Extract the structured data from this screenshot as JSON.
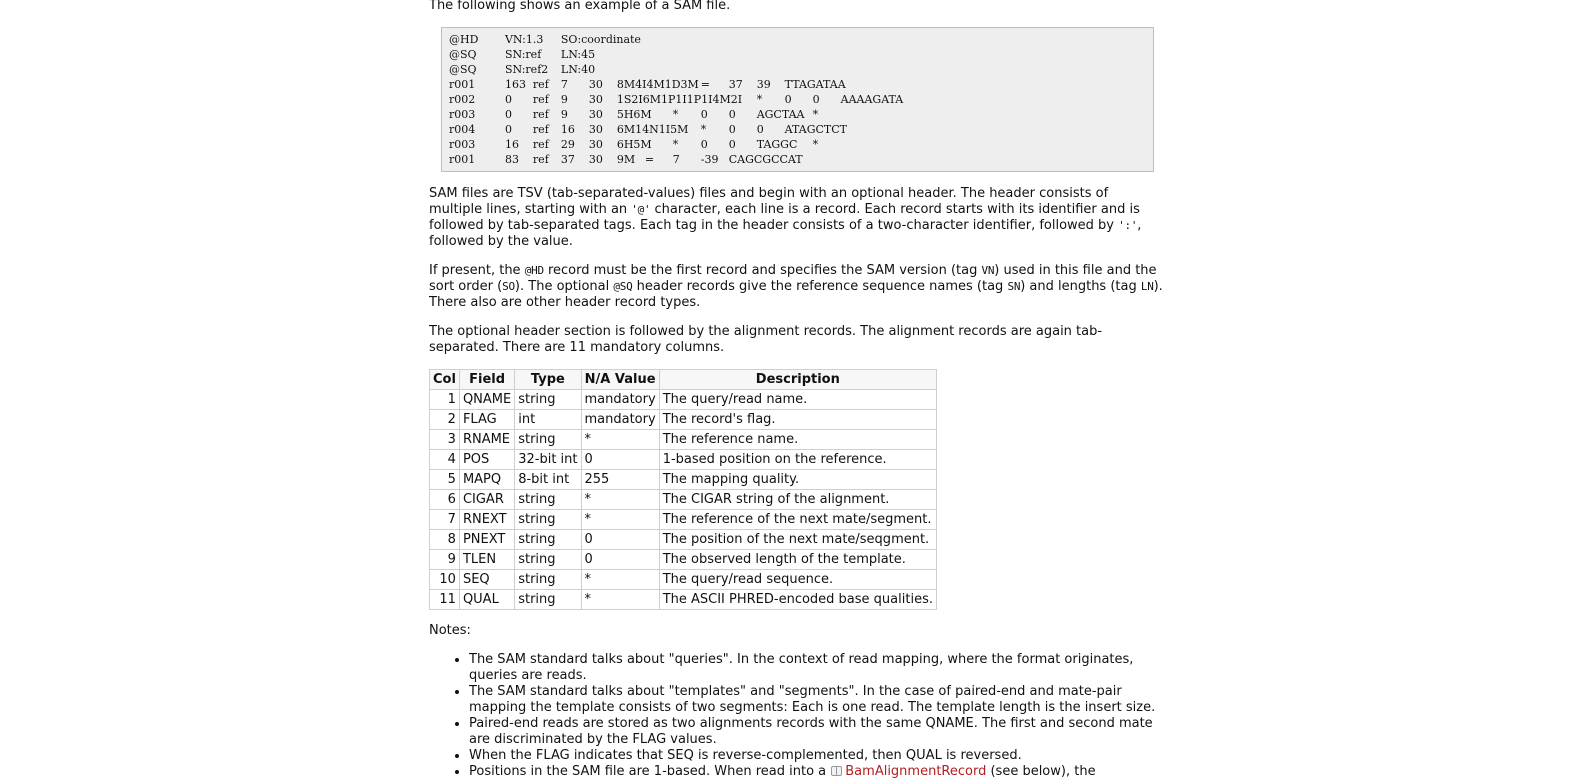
{
  "intro": "The following shows an example of a SAM file.",
  "example_sam": "@HD\tVN:1.3\tSO:coordinate\n@SQ\tSN:ref\tLN:45\n@SQ\tSN:ref2\tLN:40\nr001\t163\tref\t7\t30\t8M4I4M1D3M\t=\t37\t39\tTTAGATAA\nr002\t0\tref\t9\t30\t1S2I6M1P1I1P1I4M2I\t*\t0\t0\tAAAAGATA\nr003\t0\tref\t9\t30\t5H6M\t*\t0\t0\tAGCTAA\t*\nr004\t0\tref\t16\t30\t6M14N1I5M\t*\t0\t0\tATAGCTCT\nr003\t16\tref\t29\t30\t6H5M\t*\t0\t0\tTAGGC\t*\nr001\t83\tref\t37\t30\t9M\t=\t7\t-39\tCAGCGCCAT",
  "p1": {
    "t1": "SAM files are TSV (tab-separated-values) files and begin with an optional header. The header consists of multiple lines, starting with an ",
    "c1": "'@'",
    "t2": " character, each line is a record. Each record starts with its identifier and is followed by tab-separated tags. Each tag in the header consists of a two-character identifier, followed by ",
    "c2": "':'",
    "t3": ", followed by the value."
  },
  "p2": {
    "t1": "If present, the ",
    "c1": "@HD",
    "t2": " record must be the first record and specifies the SAM version (tag ",
    "c2": "VN",
    "t3": ") used in this file and the sort order (",
    "c3": "SO",
    "t4": "). The optional ",
    "c4": "@SQ",
    "t5": " header records give the reference sequence names (tag ",
    "c5": "SN",
    "t6": ") and lengths (tag ",
    "c6": "LN",
    "t7": "). There also are other header record types."
  },
  "p3": "The optional header section is followed by the alignment records. The alignment records are again tab-separated. There are 11 mandatory columns.",
  "table": {
    "headers": [
      "Col",
      "Field",
      "Type",
      "N/A Value",
      "Description"
    ],
    "rows": [
      [
        "1",
        "QNAME",
        "string",
        "mandatory",
        "The query/read name."
      ],
      [
        "2",
        "FLAG",
        "int",
        "mandatory",
        "The record's flag."
      ],
      [
        "3",
        "RNAME",
        "string",
        "*",
        "The reference name."
      ],
      [
        "4",
        "POS",
        "32-bit int",
        "0",
        "1-based position on the reference."
      ],
      [
        "5",
        "MAPQ",
        "8-bit int",
        "255",
        "The mapping quality."
      ],
      [
        "6",
        "CIGAR",
        "string",
        "*",
        "The CIGAR string of the alignment."
      ],
      [
        "7",
        "RNEXT",
        "string",
        "*",
        "The reference of the next mate/segment."
      ],
      [
        "8",
        "PNEXT",
        "string",
        "0",
        "The position of the next mate/seqgment."
      ],
      [
        "9",
        "TLEN",
        "string",
        "0",
        "The observed length of the template."
      ],
      [
        "10",
        "SEQ",
        "string",
        "*",
        "The query/read sequence."
      ],
      [
        "11",
        "QUAL",
        "string",
        "*",
        "The ASCII PHRED-encoded base qualities."
      ]
    ]
  },
  "notes_label": "Notes:",
  "notes": [
    "The SAM standard talks about \"queries\". In the context of read mapping, where the format originates, queries are reads.",
    "The SAM standard talks about \"templates\" and \"segments\". In the case of paired-end and mate-pair mapping the template consists of two segments: Each is one read. The template length is the insert size.",
    "Paired-end reads are stored as two alignments records with the same QNAME. The first and second mate are discriminated by the FLAG values.",
    "When the FLAG indicates that SEQ is reverse-complemented, then QUAL is reversed."
  ],
  "note5": {
    "before": "Positions in the SAM file are 1-based. When read into a ",
    "link": "BamAlignmentRecord",
    "after": " (see below), the"
  },
  "icons": {
    "link_icon": "book-icon"
  },
  "colors": {
    "link": "#b22020",
    "code_background": "#eeeeee",
    "table_border": "#cfcfcf"
  }
}
